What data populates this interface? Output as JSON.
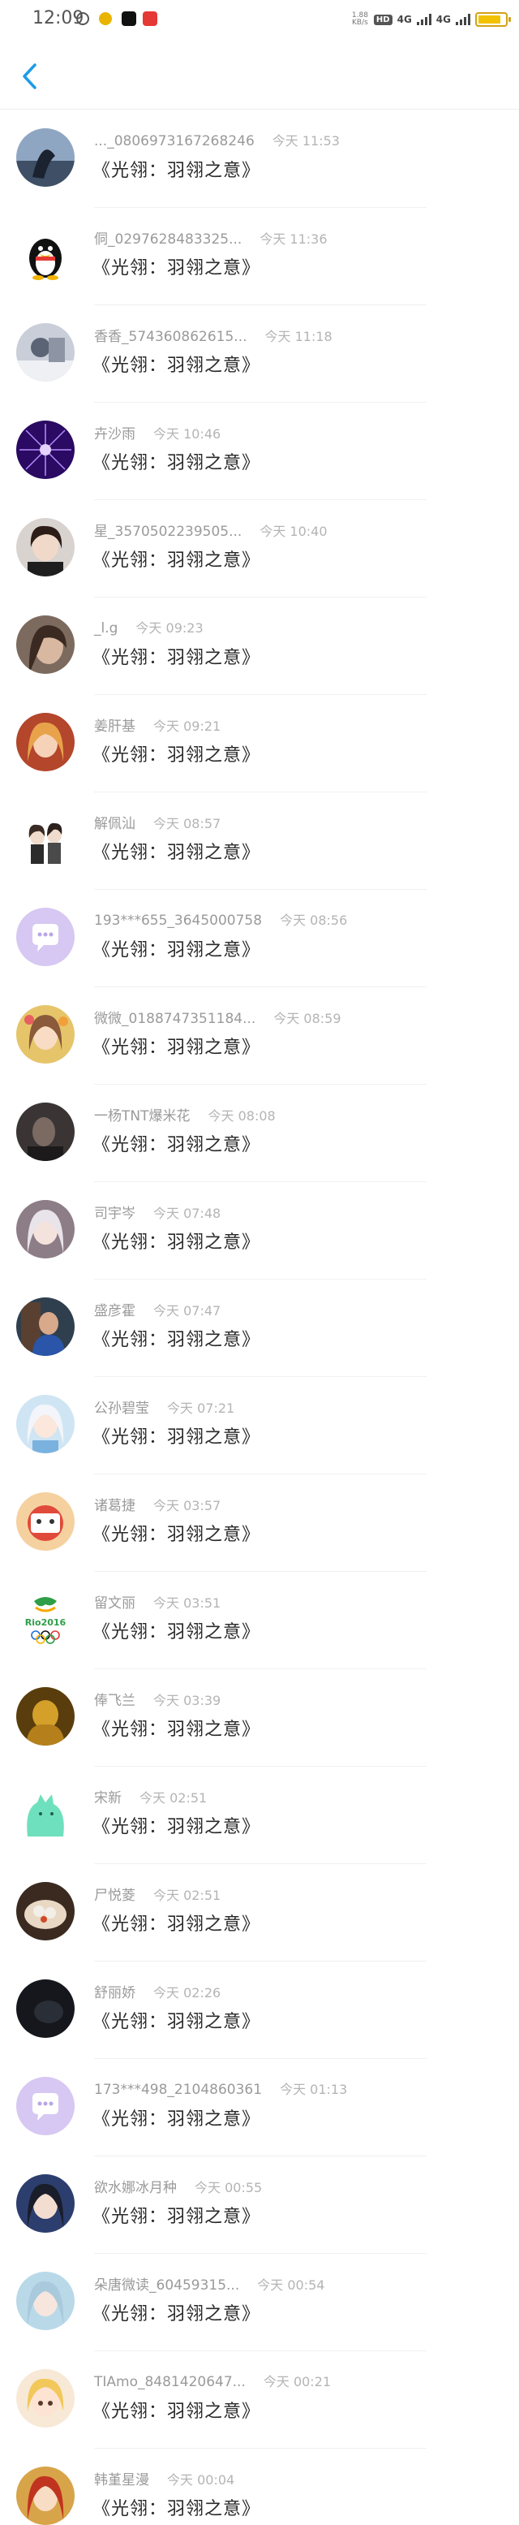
{
  "status_bar": {
    "time": "12:09",
    "speed_top": "1.88",
    "speed_bottom": "KB/s",
    "hd_badge": "HD",
    "net_1": "4G",
    "net_2": "4G",
    "battery_level": 0.85,
    "accent": "#f2c200"
  },
  "nav": {
    "back_icon": "chevron-left-icon",
    "accent": "#1e9be6"
  },
  "messages": [
    {
      "name": "..._0806973167268246",
      "time": "今天 11:53",
      "text": "《光翎：羽翎之意》",
      "avatar": "whale-photo"
    },
    {
      "name": "侗_0297628483325...",
      "time": "今天 11:36",
      "text": "《光翎：羽翎之意》",
      "avatar": "qq-penguin"
    },
    {
      "name": "香香_574360862615...",
      "time": "今天 11:18",
      "text": "《光翎：羽翎之意》",
      "avatar": "winter-photo"
    },
    {
      "name": "卉沙雨",
      "time": "今天 10:46",
      "text": "《光翎：羽翎之意》",
      "avatar": "purple-firework"
    },
    {
      "name": "星_3570502239505...",
      "time": "今天 10:40",
      "text": "《光翎：羽翎之意》",
      "avatar": "girl-portrait"
    },
    {
      "name": "_l.g",
      "time": "今天 09:23",
      "text": "《光翎：羽翎之意》",
      "avatar": "girl-closeup"
    },
    {
      "name": "姜肝基",
      "time": "今天 09:21",
      "text": "《光翎：羽翎之意》",
      "avatar": "anime-girl-red"
    },
    {
      "name": "解佩汕",
      "time": "今天 08:57",
      "text": "《光翎：羽翎之意》",
      "avatar": "couple-drawing"
    },
    {
      "name": "193***655_3645000758",
      "time": "今天 08:56",
      "text": "《光翎：羽翎之意》",
      "avatar": "default-chat"
    },
    {
      "name": "微微_0188747351184...",
      "time": "今天 08:59",
      "text": "《光翎：羽翎之意》",
      "avatar": "anime-girl-flowers"
    },
    {
      "name": "一杨TNT爆米花",
      "time": "今天 08:08",
      "text": "《光翎：羽翎之意》",
      "avatar": "dark-portrait"
    },
    {
      "name": "司宇岑",
      "time": "今天 07:48",
      "text": "《光翎：羽翎之意》",
      "avatar": "anime-girl-white"
    },
    {
      "name": "盛彦霍",
      "time": "今天 07:47",
      "text": "《光翎：羽翎之意》",
      "avatar": "elder-photo"
    },
    {
      "name": "公孙碧莹",
      "time": "今天 07:21",
      "text": "《光翎：羽翎之意》",
      "avatar": "anime-girl-blue"
    },
    {
      "name": "诸葛捷",
      "time": "今天 03:57",
      "text": "《光翎：羽翎之意》",
      "avatar": "cartoon-cat"
    },
    {
      "name": "留文丽",
      "time": "今天 03:51",
      "text": "《光翎：羽翎之意》",
      "avatar": "rio-2016-logo"
    },
    {
      "name": "俸飞兰",
      "time": "今天 03:39",
      "text": "《光翎：羽翎之意》",
      "avatar": "golden-figure"
    },
    {
      "name": "宋新",
      "time": "今天 02:51",
      "text": "《光翎：羽翎之意》",
      "avatar": "mint-cat"
    },
    {
      "name": "尸悦菱",
      "time": "今天 02:51",
      "text": "《光翎：羽翎之意》",
      "avatar": "food-bowl"
    },
    {
      "name": "舒丽娇",
      "time": "今天 02:26",
      "text": "《光翎：羽翎之意》",
      "avatar": "dark-scene"
    },
    {
      "name": "173***498_2104860361",
      "time": "今天 01:13",
      "text": "《光翎：羽翎之意》",
      "avatar": "default-chat"
    },
    {
      "name": "欲水娜冰月种",
      "time": "今天 00:55",
      "text": "《光翎：羽翎之意》",
      "avatar": "anime-girl-dark"
    },
    {
      "name": "朵唐微读_60459315...",
      "time": "今天 00:54",
      "text": "《光翎：羽翎之意》",
      "avatar": "anime-girl-light"
    },
    {
      "name": "TIAmo_8481420647...",
      "time": "今天 00:21",
      "text": "《光翎：羽翎之意》",
      "avatar": "chibi-girl"
    },
    {
      "name": "韩堇星漫",
      "time": "今天 00:04",
      "text": "《光翎：羽翎之意》",
      "avatar": "anime-red-hair"
    }
  ]
}
